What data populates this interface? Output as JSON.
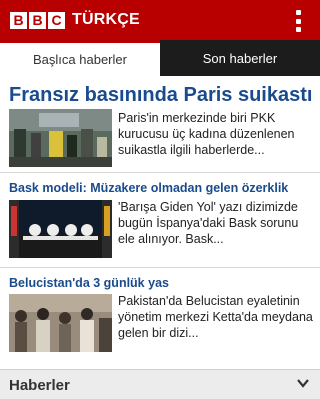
{
  "header": {
    "logo_letters": [
      "B",
      "B",
      "C"
    ],
    "service_name": "TÜRKÇE",
    "brand_color": "#b80000"
  },
  "tabs": [
    {
      "label": "Başlıca haberler",
      "active": true
    },
    {
      "label": "Son haberler",
      "active": false
    }
  ],
  "stories": [
    {
      "title": "Fransız basınında Paris suikastı",
      "summary": "Paris'in merkezinde biri PKK kurucusu üç kadına düzenlenen suikastla ilgili haberlerde..."
    },
    {
      "title": "Bask modeli: Müzakere olmadan gelen özerklik",
      "summary": "'Barışa Giden Yol' yazı dizimizde bugün İspanya'daki Bask sorunu ele alınıyor. Bask..."
    },
    {
      "title": "Belucistan'da 3 günlük yas",
      "summary": "Pakistan'da Belucistan eyaletinin yönetim merkezi Ketta'da meydana gelen bir dizi..."
    }
  ],
  "bottom_section": {
    "title": "Haberler"
  },
  "colors": {
    "headline_blue": "#1a4b8c",
    "tab_dark": "#1c1c1c"
  }
}
